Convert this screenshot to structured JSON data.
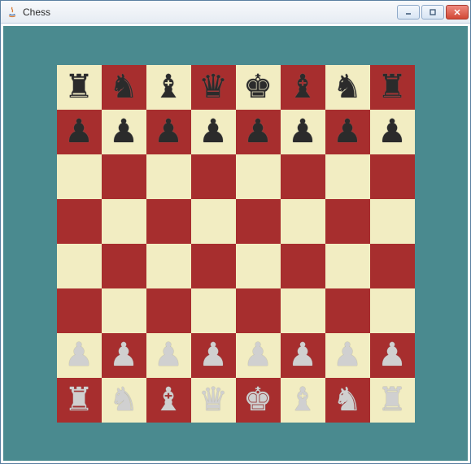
{
  "window": {
    "title": "Chess",
    "app_icon": "java-icon"
  },
  "controls": {
    "minimize": "–",
    "maximize": "▢",
    "close": "✕"
  },
  "board": {
    "size": 8,
    "light_color": "#f2edc2",
    "dark_color": "#a72e2e",
    "surface_color": "#4a8a8f",
    "ranks": [
      {
        "row": 8,
        "cells": [
          {
            "piece": "rook",
            "color": "black",
            "glyph": "♜"
          },
          {
            "piece": "knight",
            "color": "black",
            "glyph": "♞"
          },
          {
            "piece": "bishop",
            "color": "black",
            "glyph": "♝"
          },
          {
            "piece": "queen",
            "color": "black",
            "glyph": "♛"
          },
          {
            "piece": "king",
            "color": "black",
            "glyph": "♚"
          },
          {
            "piece": "bishop",
            "color": "black",
            "glyph": "♝"
          },
          {
            "piece": "knight",
            "color": "black",
            "glyph": "♞"
          },
          {
            "piece": "rook",
            "color": "black",
            "glyph": "♜"
          }
        ]
      },
      {
        "row": 7,
        "cells": [
          {
            "piece": "pawn",
            "color": "black",
            "glyph": "♟"
          },
          {
            "piece": "pawn",
            "color": "black",
            "glyph": "♟"
          },
          {
            "piece": "pawn",
            "color": "black",
            "glyph": "♟"
          },
          {
            "piece": "pawn",
            "color": "black",
            "glyph": "♟"
          },
          {
            "piece": "pawn",
            "color": "black",
            "glyph": "♟"
          },
          {
            "piece": "pawn",
            "color": "black",
            "glyph": "♟"
          },
          {
            "piece": "pawn",
            "color": "black",
            "glyph": "♟"
          },
          {
            "piece": "pawn",
            "color": "black",
            "glyph": "♟"
          }
        ]
      },
      {
        "row": 6,
        "cells": [
          {
            "piece": null
          },
          {
            "piece": null
          },
          {
            "piece": null
          },
          {
            "piece": null
          },
          {
            "piece": null
          },
          {
            "piece": null
          },
          {
            "piece": null
          },
          {
            "piece": null
          }
        ]
      },
      {
        "row": 5,
        "cells": [
          {
            "piece": null
          },
          {
            "piece": null
          },
          {
            "piece": null
          },
          {
            "piece": null
          },
          {
            "piece": null
          },
          {
            "piece": null
          },
          {
            "piece": null
          },
          {
            "piece": null
          }
        ]
      },
      {
        "row": 4,
        "cells": [
          {
            "piece": null
          },
          {
            "piece": null
          },
          {
            "piece": null
          },
          {
            "piece": null
          },
          {
            "piece": null
          },
          {
            "piece": null
          },
          {
            "piece": null
          },
          {
            "piece": null
          }
        ]
      },
      {
        "row": 3,
        "cells": [
          {
            "piece": null
          },
          {
            "piece": null
          },
          {
            "piece": null
          },
          {
            "piece": null
          },
          {
            "piece": null
          },
          {
            "piece": null
          },
          {
            "piece": null
          },
          {
            "piece": null
          }
        ]
      },
      {
        "row": 2,
        "cells": [
          {
            "piece": "pawn",
            "color": "white",
            "glyph": "♟"
          },
          {
            "piece": "pawn",
            "color": "white",
            "glyph": "♟"
          },
          {
            "piece": "pawn",
            "color": "white",
            "glyph": "♟"
          },
          {
            "piece": "pawn",
            "color": "white",
            "glyph": "♟"
          },
          {
            "piece": "pawn",
            "color": "white",
            "glyph": "♟"
          },
          {
            "piece": "pawn",
            "color": "white",
            "glyph": "♟"
          },
          {
            "piece": "pawn",
            "color": "white",
            "glyph": "♟"
          },
          {
            "piece": "pawn",
            "color": "white",
            "glyph": "♟"
          }
        ]
      },
      {
        "row": 1,
        "cells": [
          {
            "piece": "rook",
            "color": "white",
            "glyph": "♜"
          },
          {
            "piece": "knight",
            "color": "white",
            "glyph": "♞"
          },
          {
            "piece": "bishop",
            "color": "white",
            "glyph": "♝"
          },
          {
            "piece": "queen",
            "color": "white",
            "glyph": "♛"
          },
          {
            "piece": "king",
            "color": "white",
            "glyph": "♚"
          },
          {
            "piece": "bishop",
            "color": "white",
            "glyph": "♝"
          },
          {
            "piece": "knight",
            "color": "white",
            "glyph": "♞"
          },
          {
            "piece": "rook",
            "color": "white",
            "glyph": "♜"
          }
        ]
      }
    ]
  }
}
